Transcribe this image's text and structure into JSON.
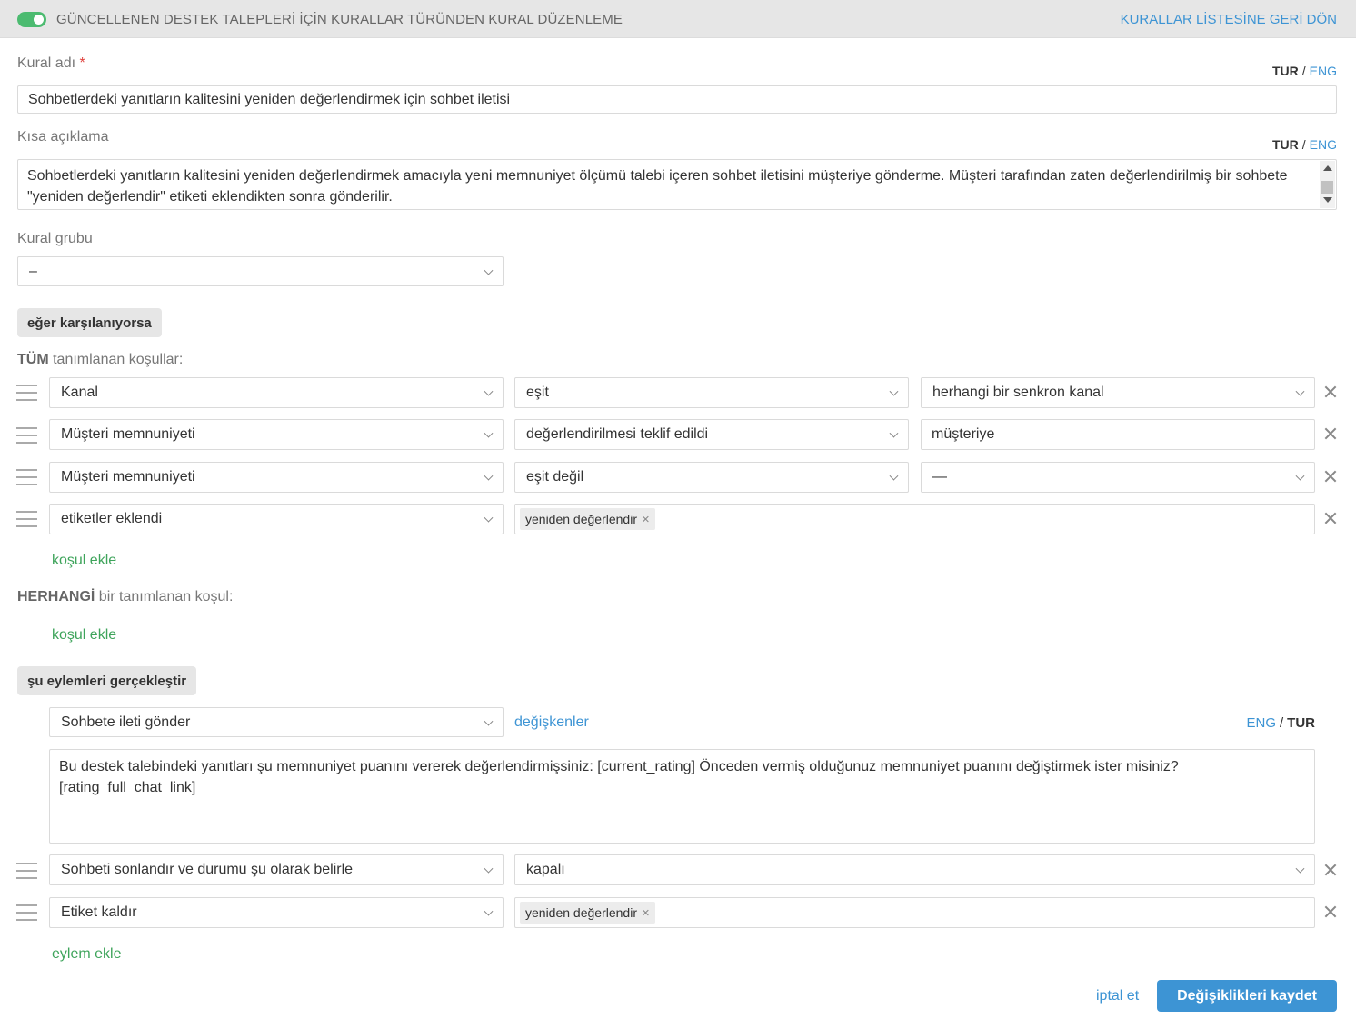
{
  "header": {
    "title": "GÜNCELLENEN DESTEK TALEPLERİ İÇİN KURALLAR TÜRÜNDEN KURAL DÜZENLEME",
    "back_link": "KURALLAR LİSTESİNE GERİ DÖN",
    "enabled": true
  },
  "rule_name": {
    "label": "Kural adı",
    "required_mark": "*",
    "lang_current": "TUR",
    "lang_sep": "/",
    "lang_alt": "ENG",
    "value": "Sohbetlerdeki yanıtların kalitesini yeniden değerlendirmek için sohbet iletisi"
  },
  "description": {
    "label": "Kısa açıklama",
    "lang_current": "TUR",
    "lang_sep": "/",
    "lang_alt": "ENG",
    "value": "Sohbetlerdeki yanıtların kalitesini yeniden değerlendirmek amacıyla yeni memnuniyet ölçümü talebi içeren sohbet iletisini müşteriye gönderme. Müşteri tarafından zaten değerlendirilmiş bir sohbete \"yeniden değerlendir\" etiketi eklendikten sonra gönderilir."
  },
  "rule_group": {
    "label": "Kural grubu",
    "value": "–"
  },
  "conditions_section": {
    "button": "eğer karşılanıyorsa",
    "all_prefix": "TÜM",
    "all_suffix": "tanımlanan koşullar:",
    "rows": [
      {
        "field": "Kanal",
        "operator": "eşit",
        "value": "herhangi bir senkron kanal"
      },
      {
        "field": "Müşteri memnuniyeti",
        "operator": "değerlendirilmesi teklif edildi",
        "value": "müşteriye"
      },
      {
        "field": "Müşteri memnuniyeti",
        "operator": "eşit değil",
        "value": "—"
      },
      {
        "field": "etiketler eklendi",
        "tag": "yeniden değerlendir",
        "tag_remove": "×"
      }
    ],
    "add_all": "koşul ekle",
    "any_prefix": "HERHANGİ",
    "any_suffix": "bir tanımlanan koşul:",
    "add_any": "koşul ekle"
  },
  "actions_section": {
    "button": "şu eylemleri gerçekleştir",
    "message_action": "Sohbete ileti gönder",
    "variables_link": "değişkenler",
    "lang_alt": "ENG",
    "lang_sep": "/",
    "lang_current": "TUR",
    "message_text_line1": "Bu destek talebindeki yanıtları şu memnuniyet puanını vererek değerlendirmişsiniz: [current_rating] Önceden vermiş olduğunuz memnuniyet puanını değiştirmek ister misiniz?",
    "message_text_line2": "[rating_full_chat_link]",
    "rows": [
      {
        "action": "Sohbeti sonlandır ve durumu şu olarak belirle",
        "value": "kapalı"
      },
      {
        "action": "Etiket kaldır",
        "tag": "yeniden değerlendir",
        "tag_remove": "×"
      }
    ],
    "add_action": "eylem ekle"
  },
  "footer": {
    "cancel": "iptal et",
    "save": "Değişiklikleri kaydet"
  },
  "colors": {
    "accent_blue": "#3d94d4",
    "accent_green": "#3ea45b",
    "toggle_on": "#4cbb70",
    "header_bg": "#e6e6e6"
  }
}
